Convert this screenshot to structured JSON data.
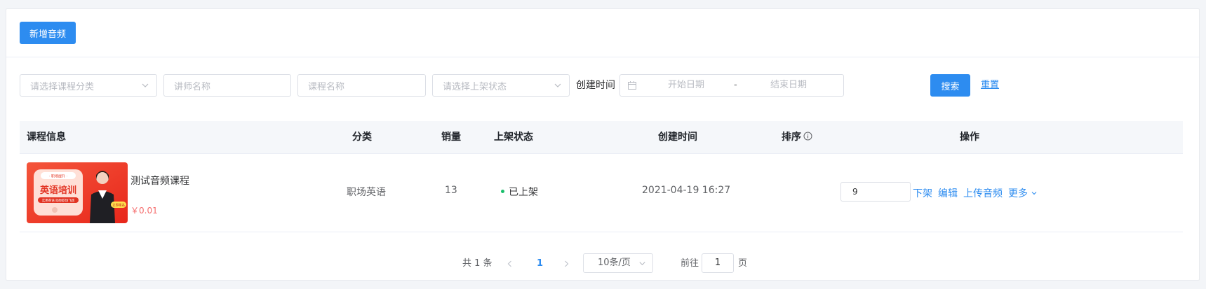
{
  "header": {
    "add_button": "新增音频"
  },
  "filters": {
    "category_placeholder": "请选择课程分类",
    "teacher_placeholder": "讲师名称",
    "course_placeholder": "课程名称",
    "status_placeholder": "请选择上架状态",
    "created_label": "创建时间",
    "start_date_placeholder": "开始日期",
    "range_separator": "-",
    "end_date_placeholder": "结束日期",
    "search_button": "搜索",
    "reset_link": "重置"
  },
  "table": {
    "columns": [
      "课程信息",
      "分类",
      "销量",
      "上架状态",
      "创建时间",
      "排序",
      "操作"
    ],
    "rows": [
      {
        "thumbnail": {
          "tag": "· 职场提升 ·",
          "title": "英语培训",
          "subtitle": "实用英语 助你职场飞跃",
          "badge": "立即报名"
        },
        "name": "测试音频课程",
        "price": "￥0.01",
        "category": "职场英语",
        "sales": "13",
        "status": "已上架",
        "created": "2021-04-19 16:27",
        "sort": "9",
        "actions": {
          "unpublish": "下架",
          "edit": "编辑",
          "upload": "上传音频",
          "more": "更多"
        }
      }
    ]
  },
  "pagination": {
    "total": "共 1 条",
    "current_page": "1",
    "page_size": "10条/页",
    "goto_prefix": "前往",
    "goto_value": "1",
    "goto_suffix": "页"
  },
  "colors": {
    "primary": "#2d8cf0",
    "success": "#19be6b",
    "price": "#f56c6c"
  }
}
